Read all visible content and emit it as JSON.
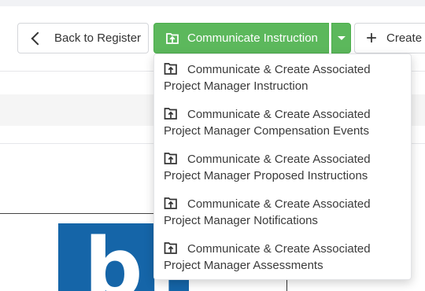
{
  "toolbar": {
    "back_label": "Back to Register",
    "communicate_label": "Communicate Instruction",
    "create_label": "Create"
  },
  "dropdown": {
    "items": [
      {
        "line1": "Communicate & Create Associated",
        "line2": "Project Manager Instruction"
      },
      {
        "line1": "Communicate & Create Associated",
        "line2": "Project Manager Compensation Events"
      },
      {
        "line1": "Communicate & Create Associated",
        "line2": "Project Manager Proposed Instructions"
      },
      {
        "line1": "Communicate & Create Associated",
        "line2": "Project Manager Notifications"
      },
      {
        "line1": "Communicate & Create Associated",
        "line2": "Project Manager Assessments"
      }
    ]
  },
  "logo": {
    "text": "bi"
  },
  "colors": {
    "primary_green": "#5cb85c",
    "logo_blue": "#1565a8"
  },
  "icons": {
    "back": "chevron-left-icon",
    "communicate": "upload-box-icon",
    "create": "plus-icon",
    "caret": "caret-down-icon"
  }
}
